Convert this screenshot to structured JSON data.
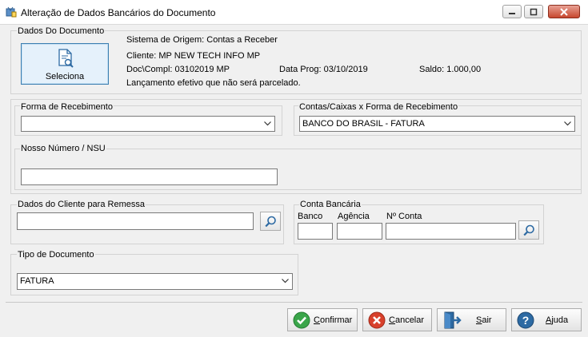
{
  "window": {
    "title": "Alteração de Dados Bancários do Documento"
  },
  "documento": {
    "group_label": "Dados Do Documento",
    "select_button": "Seleciona",
    "sistema_origem": "Sistema de Origem: Contas a Receber",
    "cliente": "Cliente: MP NEW TECH INFO MP",
    "doc_compl": "Doc\\Compl: 03102019 MP",
    "data_prog": "Data Prog: 03/10/2019",
    "saldo": "Saldo: 1.000,00",
    "lancamento": "Lançamento efetivo que não será parcelado."
  },
  "recebimento": {
    "forma_label": "Forma de Recebimento",
    "forma_value": "",
    "contas_label": "Contas/Caixas x Forma de Recebimento",
    "contas_value": "BANCO DO BRASIL - FATURA",
    "nosso_numero_label": "Nosso Número / NSU",
    "nosso_numero_value": ""
  },
  "cliente_remessa": {
    "label": "Dados do Cliente para Remessa",
    "value": ""
  },
  "conta_bancaria": {
    "group_label": "Conta Bancária",
    "banco_label": "Banco",
    "agencia_label": "Agência",
    "conta_label": "Nº Conta"
  },
  "tipo_documento": {
    "label": "Tipo de Documento",
    "value": "FATURA"
  },
  "actions": {
    "confirmar": "Confirmar",
    "cancelar": "Cancelar",
    "sair": "Sair",
    "ajuda": "Ajuda"
  }
}
